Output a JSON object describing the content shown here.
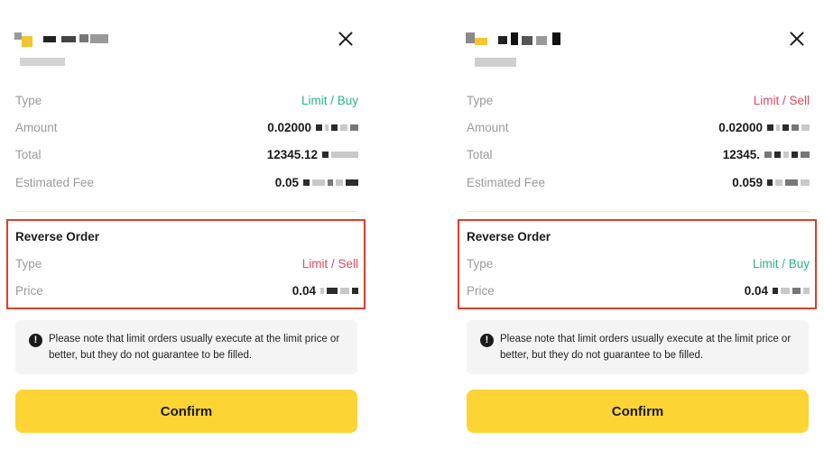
{
  "panels": [
    {
      "type_label": "Type",
      "type_value": "Limit / Buy",
      "amount_label": "Amount",
      "amount_value": "0.02000",
      "total_label": "Total",
      "total_value": "12345.12",
      "fee_label": "Estimated Fee",
      "fee_value": "0.05",
      "reverse_title": "Reverse Order",
      "reverse_type_label": "Type",
      "reverse_type_value": "Limit / Sell",
      "reverse_price_label": "Price",
      "reverse_price_value": "0.04",
      "notice": "Please note that limit orders usually execute at the limit price or better, but they do not guarantee to be filled.",
      "confirm_label": "Confirm"
    },
    {
      "type_label": "Type",
      "type_value": "Limit / Sell",
      "amount_label": "Amount",
      "amount_value": "0.02000",
      "total_label": "Total",
      "total_value": "12345.",
      "fee_label": "Estimated Fee",
      "fee_value": "0.059",
      "reverse_title": "Reverse Order",
      "reverse_type_label": "Type",
      "reverse_type_value": "Limit / Buy",
      "reverse_price_label": "Price",
      "reverse_price_value": "0.04",
      "notice": "Please note that limit orders usually execute at the limit price or better, but they do not guarantee to be filled.",
      "confirm_label": "Confirm"
    }
  ],
  "colors": {
    "buy": "#2eb383",
    "sell": "#e0475e",
    "confirm_bg": "#fcd535",
    "highlight_border": "#d9412b"
  },
  "icons": {
    "close": "close-icon",
    "notice": "exclamation-circle-icon"
  }
}
